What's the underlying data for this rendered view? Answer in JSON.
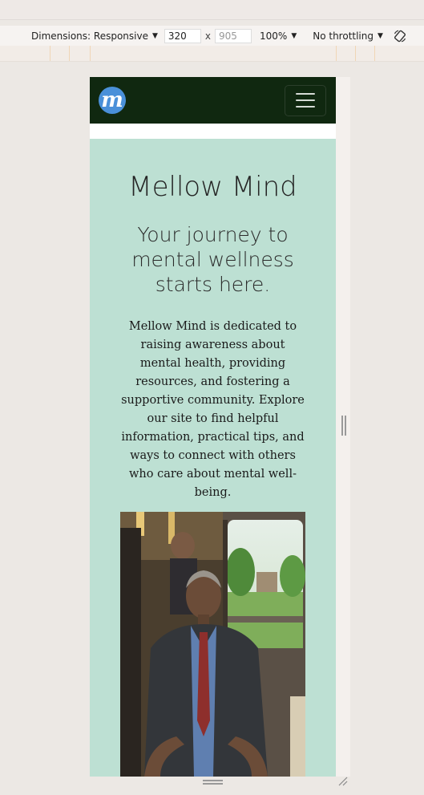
{
  "toolbar": {
    "dimensions_label": "Dimensions: Responsive",
    "width_value": "320",
    "height_placeholder": "905",
    "times": "x",
    "zoom": "100%",
    "throttle": "No throttling"
  },
  "icons": {
    "dropdown": "caret-down-icon",
    "rotate": "rotate-icon",
    "menu": "hamburger-menu-icon",
    "logo": "mellow-mind-logo"
  },
  "site": {
    "logo_letter": "m",
    "title": "Mellow Mind",
    "tagline": "Your journey to mental wellness starts here.",
    "intro": "Mellow Mind is dedicated to raising awareness about mental health, providing resources, and fostering a supportive community. Explore our site to find helpful information, practical tips, and ways to connect with others who care about mental well-being."
  },
  "colors": {
    "navbar": "#102810",
    "hero_background": "#bde0d3",
    "logo_blue": "#4a90d9"
  }
}
